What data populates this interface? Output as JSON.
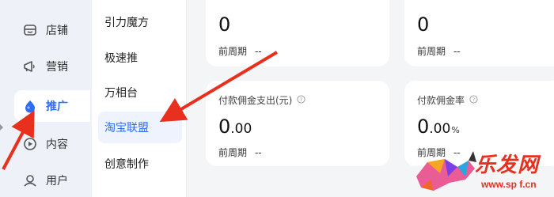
{
  "rail": {
    "items": [
      {
        "label": "店铺",
        "icon": "store-icon",
        "active": false
      },
      {
        "label": "营销",
        "icon": "megaphone-icon",
        "active": false
      },
      {
        "label": "推广",
        "icon": "promote-drop-icon",
        "active": true
      },
      {
        "label": "内容",
        "icon": "content-icon",
        "active": false
      },
      {
        "label": "用户",
        "icon": "user-icon",
        "active": false
      }
    ]
  },
  "submenu": {
    "items": [
      {
        "label": "引力魔方",
        "active": false
      },
      {
        "label": "极速推",
        "active": false
      },
      {
        "label": "万相台",
        "active": false
      },
      {
        "label": "淘宝联盟",
        "active": true
      },
      {
        "label": "创意制作",
        "active": false
      }
    ]
  },
  "cards": {
    "top_left": {
      "value": "0",
      "prev_label": "前周期",
      "prev_value": "--"
    },
    "top_right": {
      "value": "0",
      "prev_label": "前周期",
      "prev_value": "--"
    },
    "bottom_left": {
      "title": "付款佣金支出(元)",
      "value_int": "0",
      "value_dec": ".00",
      "prev_label": "前周期",
      "prev_value": "--"
    },
    "bottom_right": {
      "title": "付款佣金率",
      "value_int": "0",
      "value_dec": ".00",
      "unit": "%",
      "prev_label": "前周期",
      "prev_value": "--"
    }
  },
  "watermark": {
    "text": "乐发网",
    "url": "www.sp f.cn"
  },
  "colors": {
    "accent": "#2e6bf6",
    "arrow": "#e8301f",
    "rail_bg": "#eef1f8",
    "card_bg": "#ffffff",
    "page_bg": "#f4f5f7"
  }
}
